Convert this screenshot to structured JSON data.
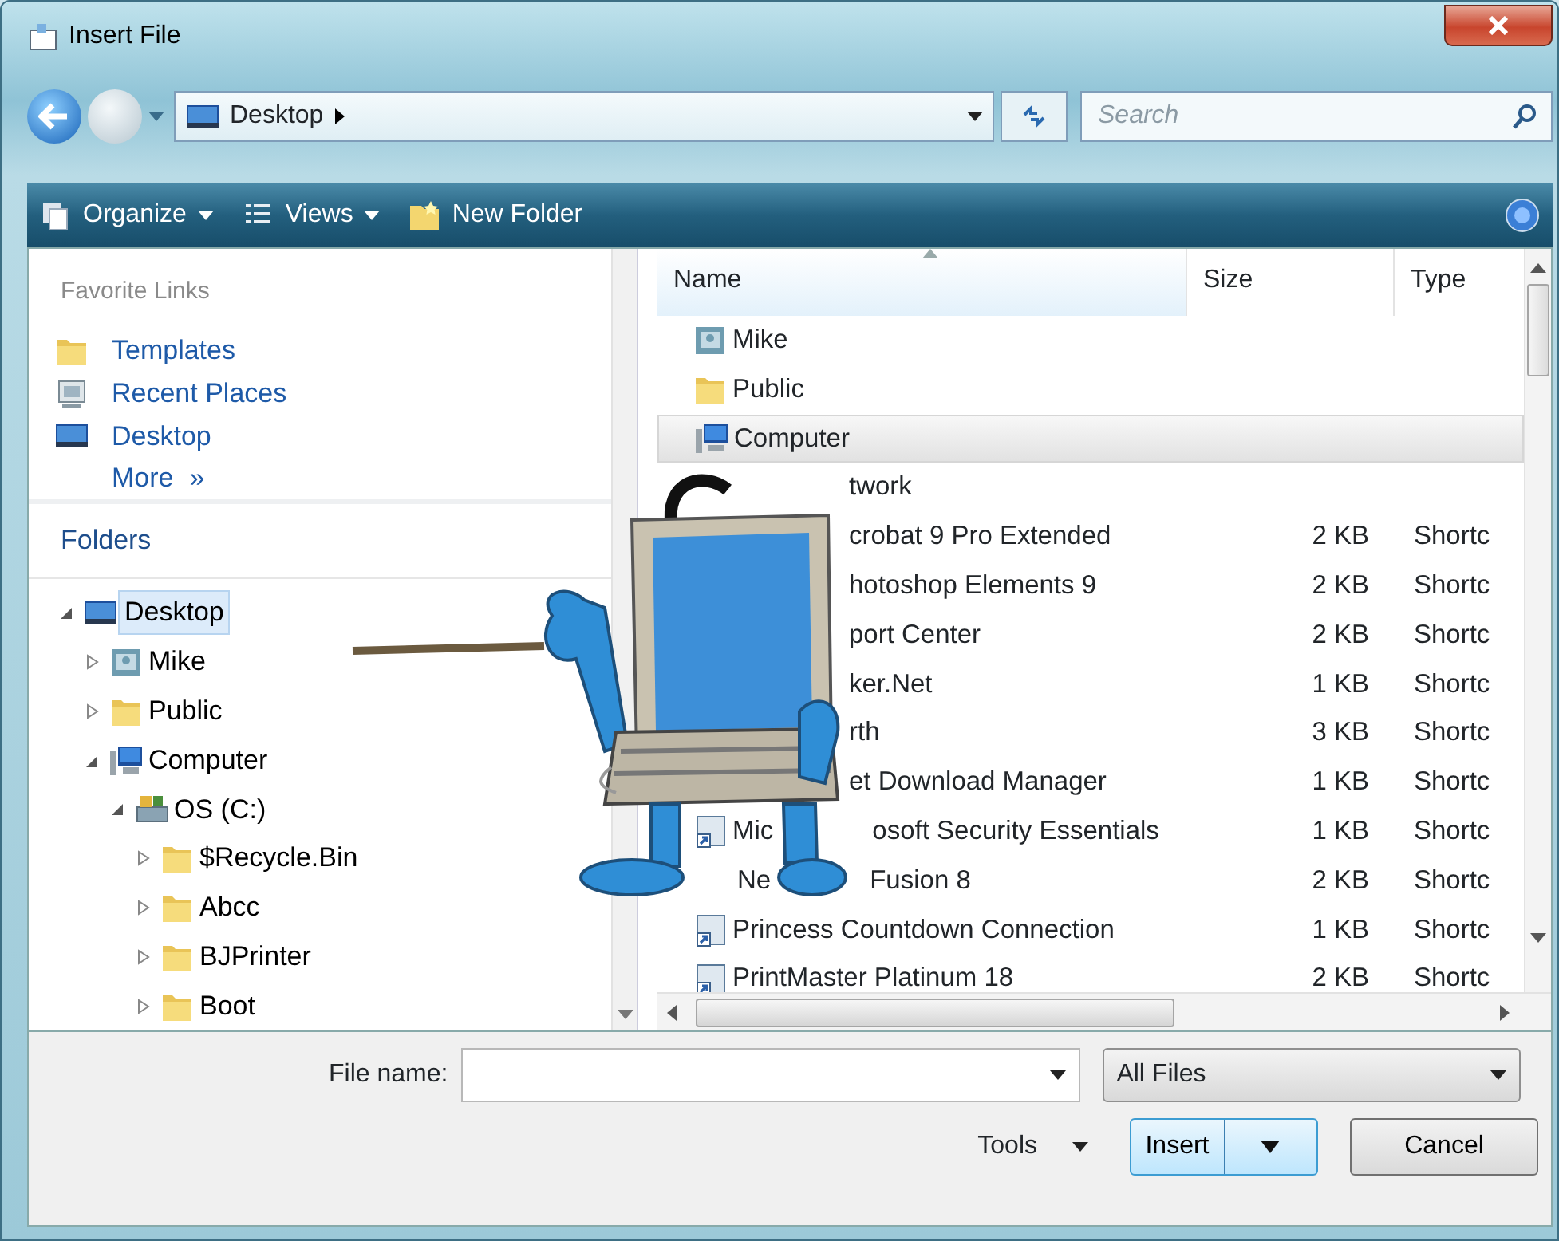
{
  "window": {
    "title": "Insert File"
  },
  "address": {
    "path": "Desktop",
    "search_placeholder": "Search"
  },
  "toolbar": [
    {
      "label": "Organize",
      "kind": "menu"
    },
    {
      "label": "Views",
      "kind": "views"
    },
    {
      "label": "New Folder",
      "kind": "new-folder"
    }
  ],
  "favorite_links": {
    "title": "Favorite Links",
    "items": [
      {
        "label": "Templates",
        "kind": "folder"
      },
      {
        "label": "Recent Places",
        "kind": "recent"
      },
      {
        "label": "Desktop",
        "kind": "desktop"
      }
    ],
    "more": {
      "label": "More",
      "glyph": "»"
    }
  },
  "folders": {
    "title": "Folders",
    "tree": [
      {
        "label": "Desktop",
        "kind": "desktop",
        "expanded": true,
        "selected": true,
        "children": [
          {
            "label": "Mike",
            "kind": "user",
            "expanded": false,
            "selected": false
          },
          {
            "label": "Public",
            "kind": "folder",
            "expanded": false,
            "selected": false
          },
          {
            "label": "Computer",
            "kind": "computer",
            "expanded": true,
            "selected": false,
            "children": [
              {
                "label": "OS (C:)",
                "kind": "drive",
                "expanded": true,
                "selected": false,
                "children": [
                  {
                    "label": "$Recycle.Bin",
                    "kind": "folder",
                    "expanded": false,
                    "selected": false
                  },
                  {
                    "label": "Abcc",
                    "kind": "folder",
                    "expanded": false,
                    "selected": false
                  },
                  {
                    "label": "BJPrinter",
                    "kind": "folder",
                    "expanded": false,
                    "selected": false
                  },
                  {
                    "label": "Boot",
                    "kind": "folder",
                    "expanded": false,
                    "selected": false
                  }
                ]
              }
            ]
          }
        ]
      }
    ]
  },
  "file_list": {
    "columns": [
      {
        "label": "Name",
        "sorted": true
      },
      {
        "label": "Size",
        "sorted": false
      },
      {
        "label": "Type",
        "sorted": false
      }
    ],
    "rows": [
      {
        "kind": "user",
        "name": "Mike",
        "selected": false
      },
      {
        "kind": "folder",
        "name": "Public",
        "selected": false
      },
      {
        "kind": "computer",
        "name": "Computer",
        "selected": true
      },
      {
        "kind": "covered",
        "name": "twork",
        "selected": false
      },
      {
        "kind": "covered",
        "name": "crobat 9 Pro Extended",
        "size": "2 KB",
        "type": "Shortc",
        "selected": false
      },
      {
        "kind": "covered",
        "name": "hotoshop Elements 9",
        "size": "2 KB",
        "type": "Shortc",
        "selected": false
      },
      {
        "kind": "covered",
        "name": "port Center",
        "size": "2 KB",
        "type": "Shortc",
        "selected": false
      },
      {
        "kind": "covered",
        "name": "ker.Net",
        "size": "1 KB",
        "type": "Shortc",
        "selected": false
      },
      {
        "kind": "covered",
        "name": "rth",
        "size": "3 KB",
        "type": "Shortc",
        "selected": false
      },
      {
        "kind": "covered",
        "name": "et Download Manager",
        "size": "1 KB",
        "type": "Shortc",
        "selected": false
      },
      {
        "kind": "shortcut",
        "name": "Mic",
        "name_after": "osoft Security Essentials",
        "size": "1 KB",
        "type": "Shortc",
        "selected": false
      },
      {
        "kind": "covered",
        "name": "Ne",
        "name_after": "Fusion 8",
        "size": "2 KB",
        "type": "Shortc",
        "selected": false
      },
      {
        "kind": "shortcut",
        "name": "Princess Countdown Connection",
        "size": "1 KB",
        "type": "Shortc",
        "selected": false
      },
      {
        "kind": "shortcut",
        "name": "PrintMaster Platinum 18",
        "size": "2 KB",
        "type": "Shortc",
        "selected": false
      }
    ]
  },
  "footer": {
    "file_name_label": "File name:",
    "file_type": "All Files",
    "tools": "Tools",
    "insert": "Insert",
    "cancel": "Cancel"
  }
}
